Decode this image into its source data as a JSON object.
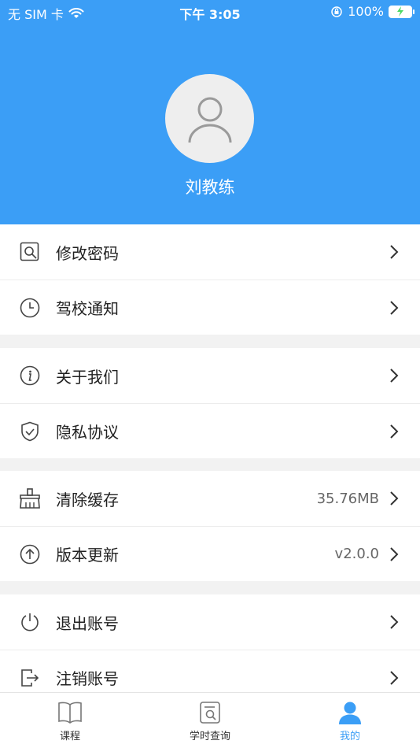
{
  "status_bar": {
    "carrier": "无 SIM 卡",
    "time": "下午 3:05",
    "battery": "100%"
  },
  "profile": {
    "name": "刘教练"
  },
  "menu": [
    {
      "label": "修改密码",
      "value": ""
    },
    {
      "label": "驾校通知",
      "value": ""
    },
    {
      "label": "关于我们",
      "value": ""
    },
    {
      "label": "隐私协议",
      "value": ""
    },
    {
      "label": "清除缓存",
      "value": "35.76MB"
    },
    {
      "label": "版本更新",
      "value": "v2.0.0"
    },
    {
      "label": "退出账号",
      "value": ""
    },
    {
      "label": "注销账号",
      "value": ""
    }
  ],
  "tabs": [
    {
      "label": "课程"
    },
    {
      "label": "学时查询"
    },
    {
      "label": "我的"
    }
  ],
  "colors": {
    "primary": "#3b9ef6",
    "background": "#f2f2f2"
  }
}
